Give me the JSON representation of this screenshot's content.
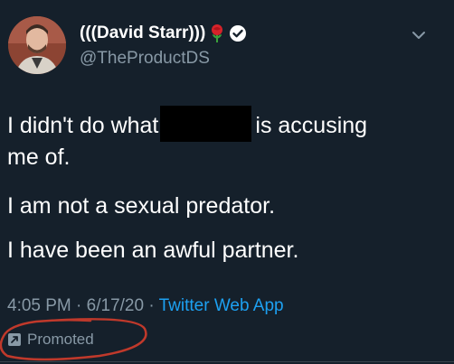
{
  "user": {
    "display_name": "(((David Starr)))",
    "handle": "@TheProductDS",
    "badge_icon": "verified-icon",
    "emoji_icon": "rose-icon"
  },
  "tweet": {
    "line1_before": "I didn't do what",
    "line1_after": "is accusing",
    "line2": "me of.",
    "paragraph2": "I am not a sexual predator.",
    "paragraph3": "I have been an awful partner."
  },
  "meta": {
    "time": "4:05 PM",
    "separator": "·",
    "date": "6/17/20",
    "source": "Twitter Web App"
  },
  "promoted": {
    "label": "Promoted",
    "icon": "promoted-arrow-icon"
  },
  "colors": {
    "background": "#15202b",
    "secondary_text": "#8899a6",
    "link": "#1da1f2",
    "annotation": "#c0392b"
  }
}
